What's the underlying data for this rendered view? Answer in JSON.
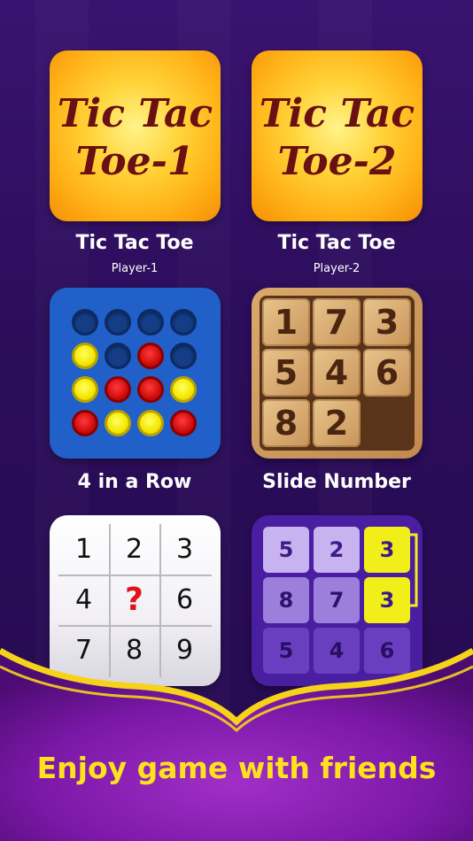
{
  "colors": {
    "background": "#2a0c52",
    "ribbon_gold": "#f7d21a",
    "tagline": "#ffe21c",
    "ttt_text": "#6a0f12",
    "four_row_board": "#2160c9"
  },
  "games": [
    {
      "id": "ttt1",
      "tile_lines": [
        "Tic Tac",
        "Toe-1"
      ],
      "title": "Tic Tac Toe",
      "subtitle": "Player-1"
    },
    {
      "id": "ttt2",
      "tile_lines": [
        "Tic Tac",
        "Toe-2"
      ],
      "title": "Tic Tac Toe",
      "subtitle": "Player-2"
    },
    {
      "id": "four",
      "title": "4 in a Row",
      "grid": [
        [
          "e",
          "e",
          "e",
          "e"
        ],
        [
          "y",
          "e",
          "r",
          "e"
        ],
        [
          "y",
          "r",
          "r",
          "y"
        ],
        [
          "r",
          "y",
          "y",
          "r"
        ]
      ]
    },
    {
      "id": "slide",
      "title": "Slide Number",
      "tiles": [
        "1",
        "7",
        "3",
        "5",
        "4",
        "6",
        "8",
        "2",
        ""
      ]
    },
    {
      "id": "sudoku",
      "cells": [
        "1",
        "2",
        "3",
        "4",
        "?",
        "6",
        "7",
        "8",
        "9"
      ]
    },
    {
      "id": "puzzle",
      "cells": [
        "5",
        "2",
        "3",
        "8",
        "7",
        "3",
        "5",
        "4",
        "6"
      ]
    }
  ],
  "tagline": "Enjoy game with friends"
}
